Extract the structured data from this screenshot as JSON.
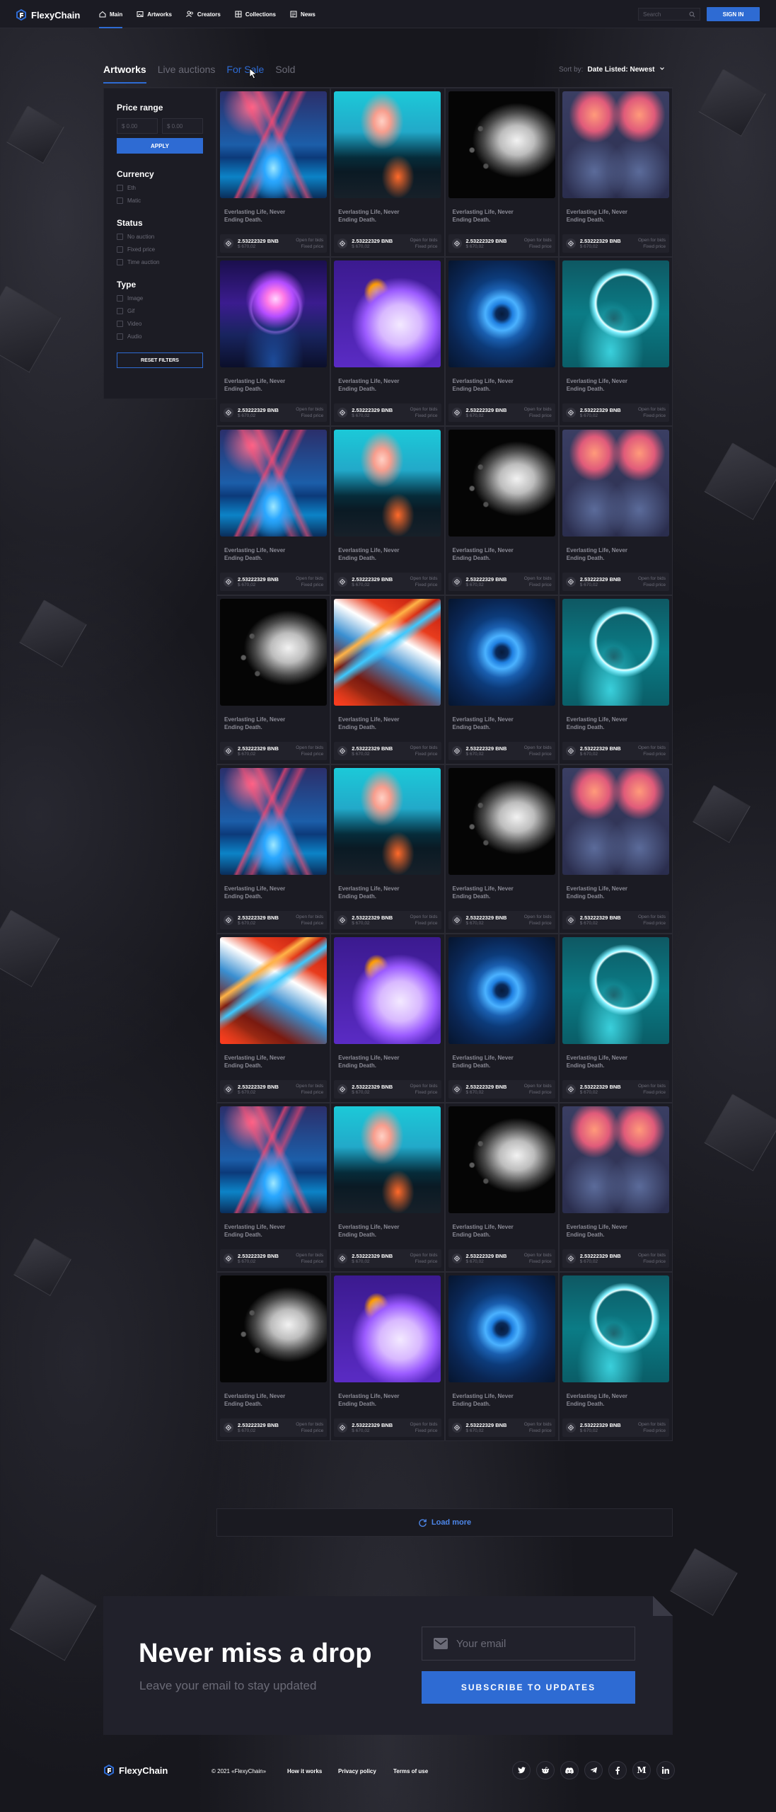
{
  "brand": {
    "name": "FlexyChain",
    "accent": "#2e6bd3"
  },
  "header": {
    "nav": [
      {
        "label": "Main",
        "icon": "home-icon",
        "active": true
      },
      {
        "label": "Artworks",
        "icon": "image-icon"
      },
      {
        "label": "Creators",
        "icon": "users-icon"
      },
      {
        "label": "Collections",
        "icon": "grid-icon"
      },
      {
        "label": "News",
        "icon": "news-icon"
      }
    ],
    "search_placeholder": "Search",
    "signin_label": "SIGN IN"
  },
  "tabs": [
    {
      "label": "Artworks",
      "active": true
    },
    {
      "label": "Live auctions"
    },
    {
      "label": "For Sale",
      "hover": true
    },
    {
      "label": "Sold"
    }
  ],
  "sort": {
    "label": "Sort by:",
    "value": "Date Listed: Newest"
  },
  "filters": {
    "price_title": "Price range",
    "price_min_placeholder": "$ 0.00",
    "price_max_placeholder": "$ 0.00",
    "apply_label": "APPLY",
    "currency_title": "Currency",
    "currency": [
      "Eth",
      "Matic"
    ],
    "status_title": "Status",
    "status": [
      "No auction",
      "Fixed price",
      "Time auction"
    ],
    "type_title": "Type",
    "type": [
      "Image",
      "Gif",
      "Video",
      "Audio"
    ],
    "reset_label": "RESET FILTERS"
  },
  "cards": [
    {
      "art": "tunnel"
    },
    {
      "art": "ocean"
    },
    {
      "art": "face"
    },
    {
      "art": "tvhead"
    },
    {
      "art": "planet"
    },
    {
      "art": "thinker"
    },
    {
      "art": "eye"
    },
    {
      "art": "portal"
    },
    {
      "art": "tunnel"
    },
    {
      "art": "ocean"
    },
    {
      "art": "face"
    },
    {
      "art": "tvhead"
    },
    {
      "art": "face"
    },
    {
      "art": "abstract"
    },
    {
      "art": "eye"
    },
    {
      "art": "portal"
    },
    {
      "art": "tunnel"
    },
    {
      "art": "ocean"
    },
    {
      "art": "face"
    },
    {
      "art": "tvhead"
    },
    {
      "art": "abstract"
    },
    {
      "art": "thinker"
    },
    {
      "art": "eye"
    },
    {
      "art": "portal"
    },
    {
      "art": "tunnel"
    },
    {
      "art": "ocean"
    },
    {
      "art": "face"
    },
    {
      "art": "tvhead"
    },
    {
      "art": "face"
    },
    {
      "art": "thinker"
    },
    {
      "art": "eye"
    },
    {
      "art": "portal"
    }
  ],
  "card_common": {
    "title": "Everlasting Life, Never Ending Death.",
    "price_crypto": "2.53222329 BNB",
    "price_usd": "$ 670,02",
    "sale_line1": "Open for bids",
    "sale_line2": "Fixed price"
  },
  "load_more_label": "Load more",
  "newsletter": {
    "title": "Never miss a drop",
    "subtitle": "Leave your email to stay updated",
    "email_placeholder": "Your email",
    "button_label": "SUBSCRIBE TO UPDATES"
  },
  "footer": {
    "copyright": "© 2021 «FlexyChain»",
    "links": [
      "How it works",
      "Privacy policy",
      "Terms of use"
    ],
    "socials": [
      "twitter-icon",
      "reddit-icon",
      "discord-icon",
      "telegram-icon",
      "facebook-icon",
      "medium-icon",
      "linkedin-icon"
    ]
  }
}
